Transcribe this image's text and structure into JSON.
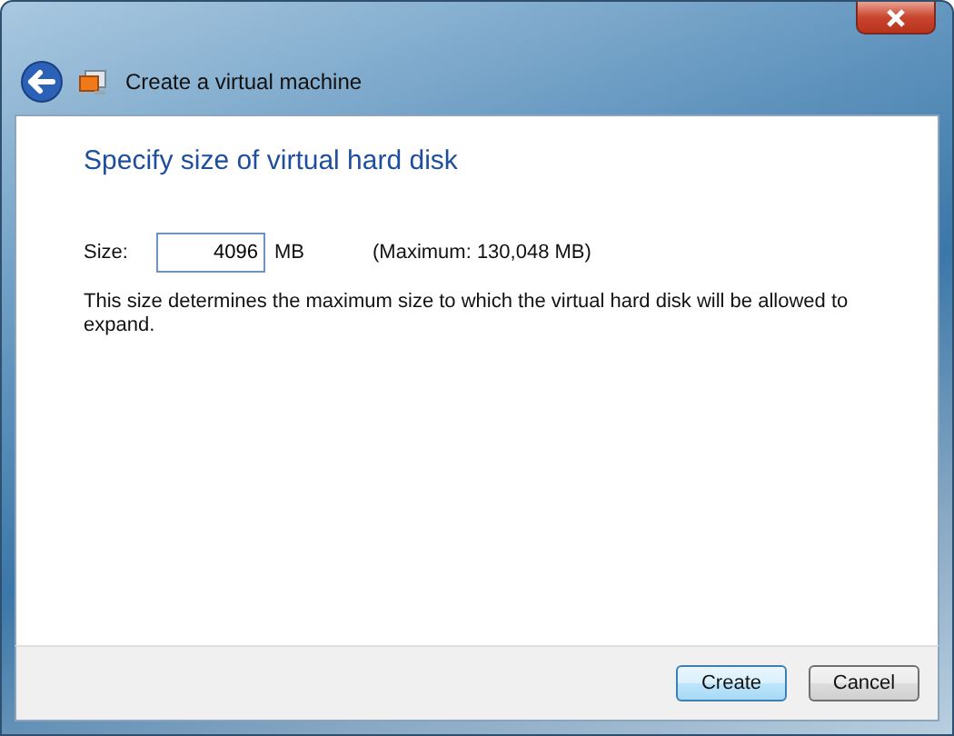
{
  "window": {
    "title": "Create a virtual machine"
  },
  "heading": "Specify size of virtual hard disk",
  "size_field": {
    "label": "Size:",
    "value": "4096",
    "unit": "MB",
    "maximum": "(Maximum: 130,048 MB)"
  },
  "description": "This size determines the maximum size to which the virtual hard disk will be allowed to expand.",
  "buttons": [
    {
      "label": "Create",
      "default": true
    },
    {
      "label": "Cancel",
      "default": false
    }
  ]
}
